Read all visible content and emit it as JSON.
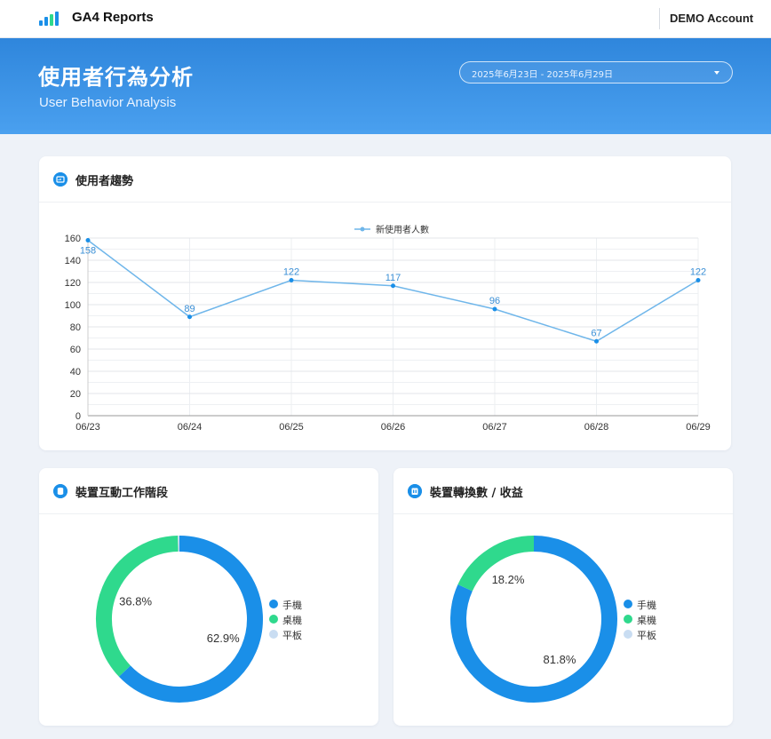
{
  "app": {
    "title": "GA4 Reports",
    "account": "DEMO Account"
  },
  "hero": {
    "title": "使用者行為分析",
    "subtitle": "User Behavior Analysis",
    "date_range": "2025年6月23日 - 2025年6月29日"
  },
  "colors": {
    "primary": "#1a8fe8",
    "line": "#6fb6ea",
    "green": "#2fd98d",
    "light": "#c9ddf2"
  },
  "trend": {
    "title": "使用者趨勢",
    "icon": "chart-icon",
    "chart_data": {
      "type": "line",
      "title": "",
      "xlabel": "",
      "ylabel": "",
      "x": [
        "06/23",
        "06/24",
        "06/25",
        "06/26",
        "06/27",
        "06/28",
        "06/29"
      ],
      "series": [
        {
          "name": "新使用者人數",
          "values": [
            158,
            89,
            122,
            117,
            96,
            67,
            122
          ]
        }
      ],
      "ylim": [
        0,
        160
      ],
      "yticks": [
        0,
        20,
        40,
        60,
        80,
        100,
        120,
        140,
        160
      ],
      "grid": true,
      "legend": "top-center",
      "data_labels": true
    }
  },
  "device": {
    "title": "裝置互動工作階段",
    "icon": "database-icon",
    "chart_data": {
      "type": "pie",
      "categories": [
        "手機",
        "桌機",
        "平板"
      ],
      "values": [
        62.9,
        36.8,
        0.3
      ],
      "value_labels": [
        "62.9%",
        "36.8%",
        ""
      ],
      "colors": [
        "#1a8fe8",
        "#2fd98d",
        "#c9ddf2"
      ],
      "legend": "right"
    }
  },
  "conversion": {
    "title": "裝置轉換數 / 收益",
    "icon": "clipboard-icon",
    "chart_data": {
      "type": "pie",
      "categories": [
        "手機",
        "桌機",
        "平板"
      ],
      "values": [
        81.8,
        18.2,
        0
      ],
      "value_labels": [
        "81.8%",
        "18.2%",
        ""
      ],
      "colors": [
        "#1a8fe8",
        "#2fd98d",
        "#c9ddf2"
      ],
      "legend": "right"
    }
  }
}
